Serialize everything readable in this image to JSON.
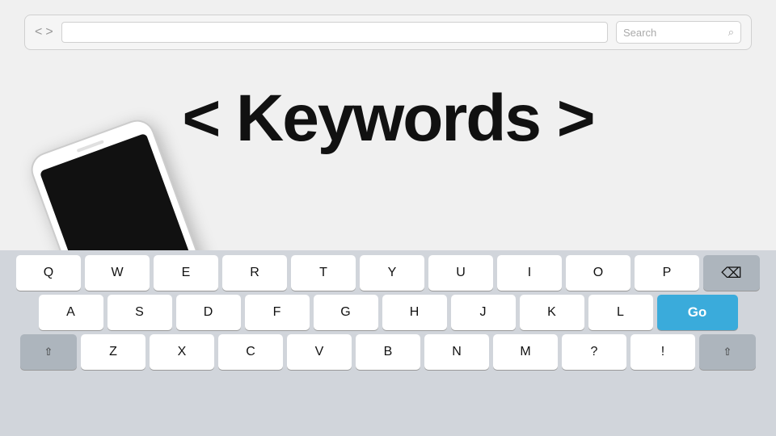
{
  "browser": {
    "back_label": "<",
    "forward_label": ">",
    "search_placeholder": "Search"
  },
  "title": {
    "text": "< Keywords >"
  },
  "keyboard": {
    "rows": [
      [
        "Q",
        "W",
        "E",
        "R",
        "T",
        "Y",
        "U",
        "I",
        "O",
        "P"
      ],
      [
        "A",
        "S",
        "D",
        "F",
        "G",
        "H",
        "J",
        "K",
        "L"
      ],
      [
        "C",
        "V",
        "B",
        "N",
        "M",
        "?",
        "!"
      ]
    ],
    "go_label": "Go"
  }
}
